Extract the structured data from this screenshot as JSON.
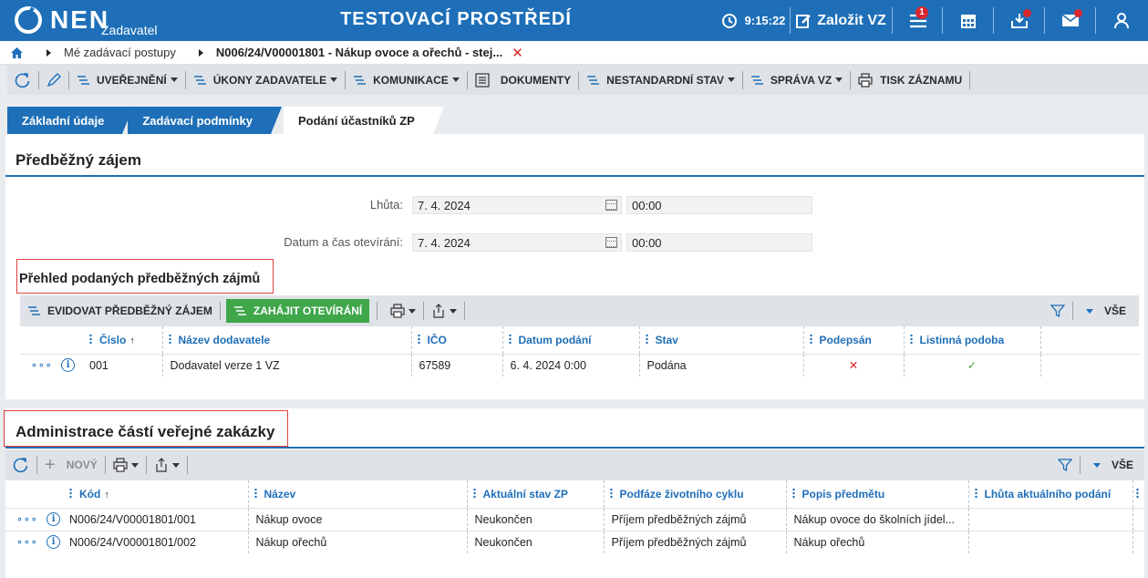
{
  "header": {
    "logo": "NEN",
    "logo_sub": "Zadavatel",
    "env_title": "TESTOVACÍ PROSTŘEDÍ",
    "time": "9:15:22",
    "create_label": "Založit VZ",
    "menu_badge": "1"
  },
  "breadcrumb": {
    "items": [
      "Mé zadávací postupy",
      "N006/24/V00001801 - Nákup ovoce a ořechů - stej..."
    ]
  },
  "toolbar": {
    "uverejneni": "UVEŘEJNĚNÍ",
    "ukony": "ÚKONY ZADAVATELE",
    "komunikace": "KOMUNIKACE",
    "dokumenty": "DOKUMENTY",
    "nestandardni": "NESTANDARDNÍ STAV",
    "sprava": "SPRÁVA VZ",
    "tisk": "TISK ZÁZNAMU"
  },
  "tabs": [
    "Základní údaje",
    "Zadávací podmínky",
    "Podání účastníků ZP"
  ],
  "predbezny": {
    "title": "Předběžný zájem",
    "lhuta_label": "Lhůta:",
    "lhuta_date": "7. 4. 2024",
    "lhuta_time": "00:00",
    "otevirani_label": "Datum a čas otevírání:",
    "otevirani_date": "7. 4. 2024",
    "otevirani_time": "00:00",
    "prehled_title": "Přehled podaných předběžných zájmů",
    "btn_evidovat": "EVIDOVAT PŘEDBĚŽNÝ ZÁJEM",
    "btn_zahajit": "ZAHÁJIT OTEVÍRÁNÍ",
    "vse": "VŠE",
    "columns": [
      "Číslo",
      "Název dodavatele",
      "IČO",
      "Datum podání",
      "Stav",
      "Podepsán",
      "Listinná podoba"
    ],
    "rows": [
      {
        "cislo": "001",
        "nazev": "Dodavatel verze 1 VZ",
        "ico": "67589",
        "datum": "6. 4. 2024 0:00",
        "stav": "Podána",
        "podepsan": "✕",
        "listinna": "✓"
      }
    ]
  },
  "administrace": {
    "title": "Administrace částí veřejné zakázky",
    "btn_novy": "NOVÝ",
    "vse": "VŠE",
    "columns": [
      "Kód",
      "Název",
      "Aktuální stav ZP",
      "Podfáze životního cyklu",
      "Popis předmětu",
      "Lhůta aktuálního podání"
    ],
    "rows": [
      {
        "kod": "N006/24/V00001801/001",
        "nazev": "Nákup ovoce",
        "stav": "Neukončen",
        "podfaze": "Příjem předběžných zájmů",
        "popis": "Nákup ovoce do školních jídel...",
        "lhuta": ""
      },
      {
        "kod": "N006/24/V00001801/002",
        "nazev": "Nákup ořechů",
        "stav": "Neukončen",
        "podfaze": "Příjem předběžných zájmů",
        "popis": "Nákup ořechů",
        "lhuta": ""
      }
    ]
  }
}
